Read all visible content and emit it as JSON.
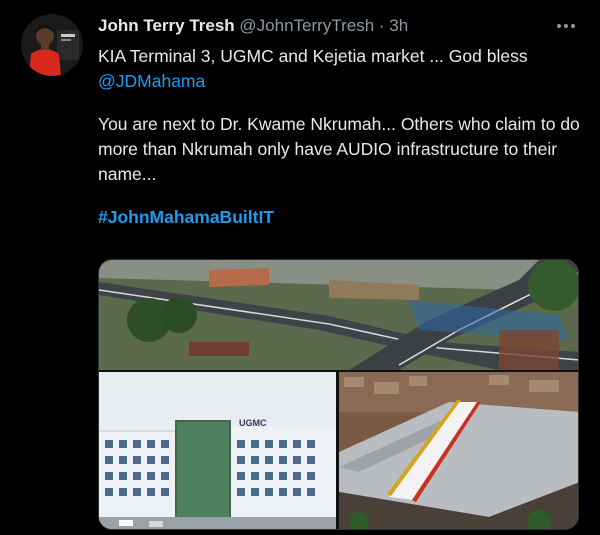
{
  "tweet": {
    "display_name": "John Terry Tresh",
    "handle": "@JohnTerryTresh",
    "separator": "·",
    "time": "3h",
    "line1": "KIA Terminal 3, UGMC and  Kejetia market ... God bless",
    "mention": "@JDMahama",
    "paragraph2": "You are next to Dr. Kwame Nkrumah... Others who claim to do more than Nkrumah only have AUDIO infrastructure to their name...",
    "hashtag": "#JohnMahamaBuiltIT"
  },
  "media": {
    "hospital_sign": "UGMC"
  },
  "colors": {
    "background": "#000000",
    "text": "#e7e9ea",
    "muted": "#8b98a5",
    "link": "#1d9bf0"
  },
  "icons": {
    "more": "more-horizontal-icon"
  }
}
